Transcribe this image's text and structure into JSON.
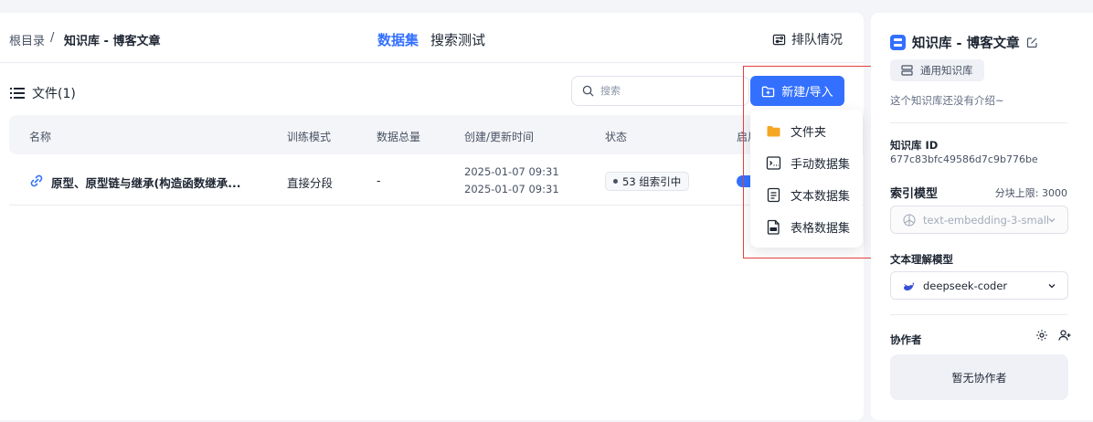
{
  "breadcrumb": {
    "root": "根目录",
    "separator": "/",
    "current": "知识库 - 博客文章"
  },
  "tabs": [
    {
      "label": "数据集",
      "active": true
    },
    {
      "label": "搜索测试",
      "active": false
    }
  ],
  "queue": {
    "label": "排队情况",
    "icon": "queue-icon"
  },
  "files": {
    "title": "文件(1)",
    "icon": "list-icon"
  },
  "search": {
    "placeholder": "搜索",
    "value": ""
  },
  "table": {
    "headers": [
      "名称",
      "训练模式",
      "数据总量",
      "创建/更新时间",
      "状态",
      "启用"
    ],
    "rows": [
      {
        "name": "原型、原型链与继承(构造函数继承...",
        "mode": "直接分段",
        "total": "-",
        "created": "2025-01-07 09:31",
        "updated": "2025-01-07 09:31",
        "status": "53 组索引中",
        "enabled": true
      }
    ]
  },
  "new_button": {
    "label": "新建/导入",
    "icon": "add-folder-icon"
  },
  "menu": {
    "items": [
      {
        "label": "文件夹",
        "icon": "folder-icon"
      },
      {
        "label": "手动数据集",
        "icon": "terminal-icon"
      },
      {
        "label": "文本数据集",
        "icon": "text-file-icon"
      },
      {
        "label": "表格数据集",
        "icon": "csv-file-icon"
      }
    ]
  },
  "sidebar": {
    "title": "知识库 - 博客文章",
    "type_badge": "通用知识库",
    "description": "这个知识库还没有介绍~",
    "id_label": "知识库 ID",
    "id_value": "677c83bfc49586d7c9b776be",
    "index_model_label": "索引模型",
    "chunk_limit": "分块上限: 3000",
    "embedding_model": "text-embedding-3-small",
    "text_model_label": "文本理解模型",
    "text_model": "deepseek-coder",
    "collaborators_label": "协作者",
    "no_collaborators": "暂无协作者"
  },
  "colors": {
    "primary": "#3370ff",
    "highlight_box": "#e34040",
    "folder": "#f5a623"
  }
}
